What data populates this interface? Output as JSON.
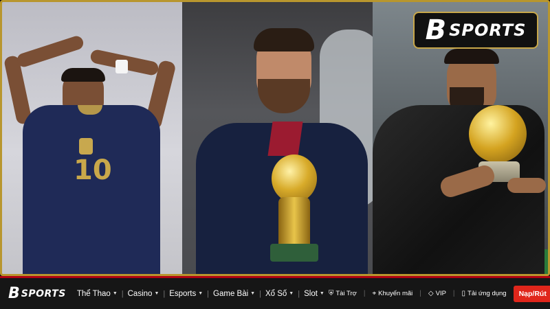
{
  "hero": {
    "badge": {
      "logo_mark": "B",
      "brand": "SPORTS"
    },
    "left_player": {
      "shirt_number": "10"
    }
  },
  "nav": {
    "logo": {
      "mark": "B",
      "brand": "SPORTS"
    },
    "menu": [
      {
        "label": "Thể Thao"
      },
      {
        "label": "Casino"
      },
      {
        "label": "Esports"
      },
      {
        "label": "Game Bài"
      },
      {
        "label": "Xổ Số"
      },
      {
        "label": "Slot"
      }
    ],
    "utilities": [
      {
        "label": "Tài Trợ",
        "icon": "shield-icon"
      },
      {
        "label": "Khuyến mãi",
        "icon": "tag-icon"
      },
      {
        "label": "VIP",
        "icon": "diamond-icon"
      },
      {
        "label": "Tải ứng dụng",
        "icon": "phone-icon"
      }
    ],
    "cta": "Nạp/Rút"
  },
  "colors": {
    "accent_red": "#e0261b",
    "border_gold": "#b8962e",
    "nav_bg": "#161616"
  }
}
